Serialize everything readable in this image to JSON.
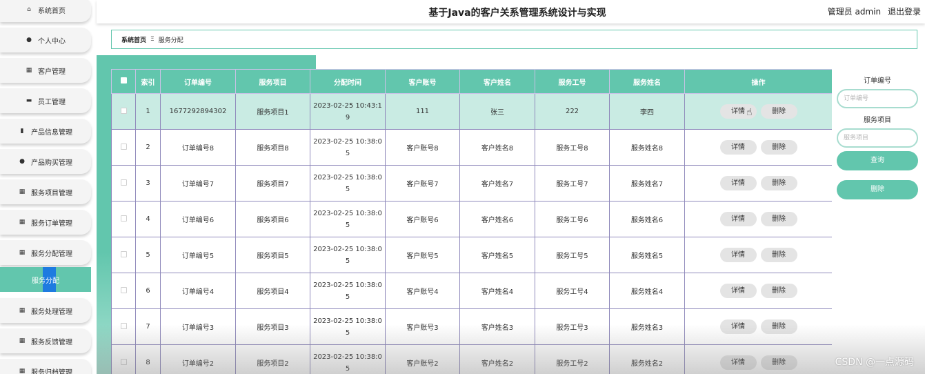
{
  "app": {
    "title": "基于Java的客户关系管理系统设计与实现"
  },
  "user": {
    "role_name": "管理员 admin",
    "logout": "退出登录"
  },
  "sidebar": {
    "items": [
      {
        "label": "系统首页",
        "icon": "home-icon"
      },
      {
        "label": "个人中心",
        "icon": "person-icon"
      },
      {
        "label": "客户管理",
        "icon": "grid-icon"
      },
      {
        "label": "员工管理",
        "icon": "id-card-icon"
      },
      {
        "label": "产品信息管理",
        "icon": "clipboard-icon"
      },
      {
        "label": "产品购买管理",
        "icon": "person-icon"
      },
      {
        "label": "服务项目管理",
        "icon": "grid-icon"
      },
      {
        "label": "服务订单管理",
        "icon": "grid-icon"
      },
      {
        "label": "服务分配管理",
        "icon": "grid-icon"
      },
      {
        "label": "服务分配",
        "icon": "",
        "active": true
      },
      {
        "label": "服务处理管理",
        "icon": "grid-icon"
      },
      {
        "label": "服务反馈管理",
        "icon": "grid-icon"
      },
      {
        "label": "服务归档管理",
        "icon": "grid-icon"
      }
    ]
  },
  "breadcrumb": {
    "home": "系统首页",
    "separator": "Ξ",
    "current": "服务分配"
  },
  "table": {
    "headers": [
      "索引",
      "订单编号",
      "服务项目",
      "分配时间",
      "客户账号",
      "客户姓名",
      "服务工号",
      "服务姓名",
      "操作"
    ],
    "rows": [
      {
        "index": "1",
        "order_no": "1677292894302",
        "service_item": "服务项目1",
        "time": "2023-02-25 10:43:1 9",
        "account": "111",
        "cust_name": "张三",
        "staff_no": "222",
        "staff_name": "李四"
      },
      {
        "index": "2",
        "order_no": "订单编号8",
        "service_item": "服务项目8",
        "time": "2023-02-25 10:38:0 5",
        "account": "客户账号8",
        "cust_name": "客户姓名8",
        "staff_no": "服务工号8",
        "staff_name": "服务姓名8"
      },
      {
        "index": "3",
        "order_no": "订单编号7",
        "service_item": "服务项目7",
        "time": "2023-02-25 10:38:0 5",
        "account": "客户账号7",
        "cust_name": "客户姓名7",
        "staff_no": "服务工号7",
        "staff_name": "服务姓名7"
      },
      {
        "index": "4",
        "order_no": "订单编号6",
        "service_item": "服务项目6",
        "time": "2023-02-25 10:38:0 5",
        "account": "客户账号6",
        "cust_name": "客户姓名6",
        "staff_no": "服务工号6",
        "staff_name": "服务姓名6"
      },
      {
        "index": "5",
        "order_no": "订单编号5",
        "service_item": "服务项目5",
        "time": "2023-02-25 10:38:0 5",
        "account": "客户账号5",
        "cust_name": "客户姓名5",
        "staff_no": "服务工号5",
        "staff_name": "服务姓名5"
      },
      {
        "index": "6",
        "order_no": "订单编号4",
        "service_item": "服务项目4",
        "time": "2023-02-25 10:38:0 5",
        "account": "客户账号4",
        "cust_name": "客户姓名4",
        "staff_no": "服务工号4",
        "staff_name": "服务姓名4"
      },
      {
        "index": "7",
        "order_no": "订单编号3",
        "service_item": "服务项目3",
        "time": "2023-02-25 10:38:0 5",
        "account": "客户账号3",
        "cust_name": "客户姓名3",
        "staff_no": "服务工号3",
        "staff_name": "服务姓名3"
      },
      {
        "index": "8",
        "order_no": "订单编号2",
        "service_item": "服务项目2",
        "time": "2023-02-25 10:38:0 5",
        "account": "客户账号2",
        "cust_name": "客户姓名2",
        "staff_no": "服务工号2",
        "staff_name": "服务姓名2"
      }
    ],
    "detail_label": "详情",
    "delete_label": "删除"
  },
  "search": {
    "order_label": "订单编号",
    "order_placeholder": "订单编号",
    "item_label": "服务项目",
    "item_placeholder": "服务项目",
    "query_label": "查询",
    "delete_label": "删除"
  },
  "watermark": "CSDN @一点源码",
  "colors": {
    "accent": "#62c6ad",
    "highlight_row": "#c9ebe3",
    "active_marker": "#1e7be0"
  }
}
